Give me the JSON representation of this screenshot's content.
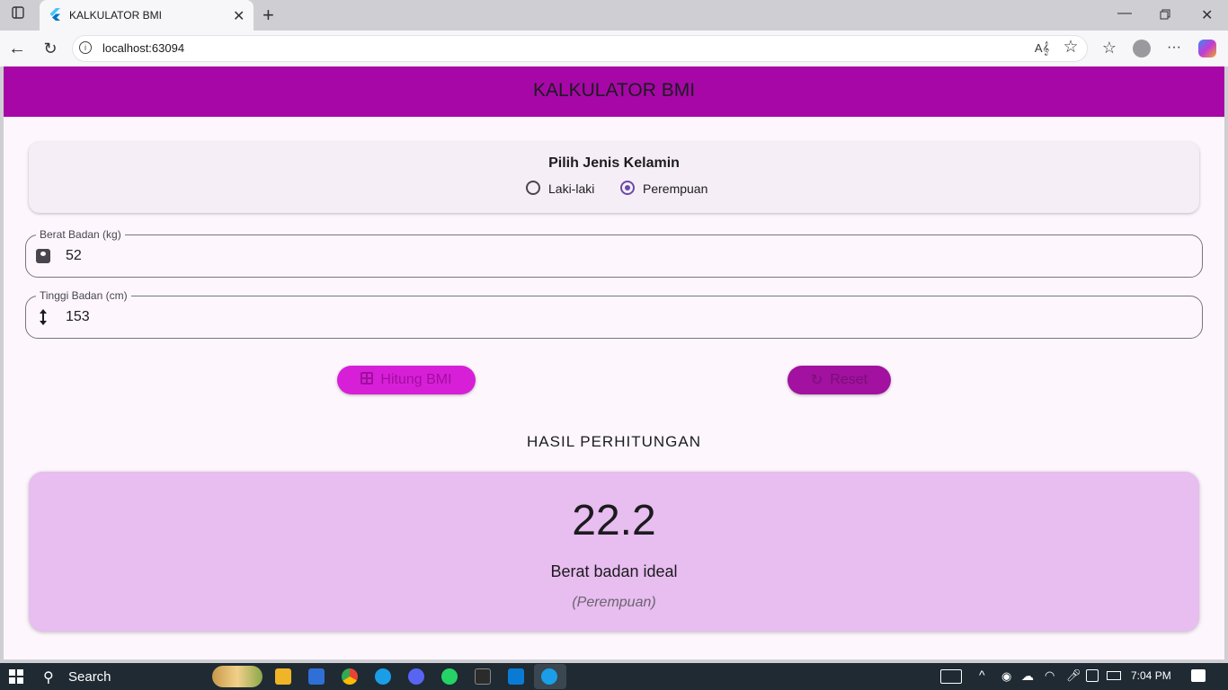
{
  "browser": {
    "tab_title": "KALKULATOR BMI",
    "url": "localhost:63094"
  },
  "app": {
    "title": "KALKULATOR BMI",
    "gender": {
      "title": "Pilih Jenis Kelamin",
      "options": [
        "Laki-laki",
        "Perempuan"
      ],
      "selected": "Perempuan"
    },
    "weight": {
      "label": "Berat Badan (kg)",
      "value": "52",
      "icon": "scale-icon"
    },
    "height": {
      "label": "Tinggi Badan (cm)",
      "value": "153",
      "icon": "height-arrows-icon"
    },
    "buttons": {
      "calculate": "Hitung BMI",
      "reset": "Reset"
    },
    "result": {
      "heading": "HASIL PERHITUNGAN",
      "bmi": "22.2",
      "category": "Berat badan ideal",
      "gender_note": "(Perempuan)"
    },
    "colors": {
      "appbar": "#a707a7",
      "result_card": "#e8bdef",
      "radio_selected": "#6a4aa8"
    }
  },
  "taskbar": {
    "search_label": "Search",
    "time": "7:04 PM"
  }
}
